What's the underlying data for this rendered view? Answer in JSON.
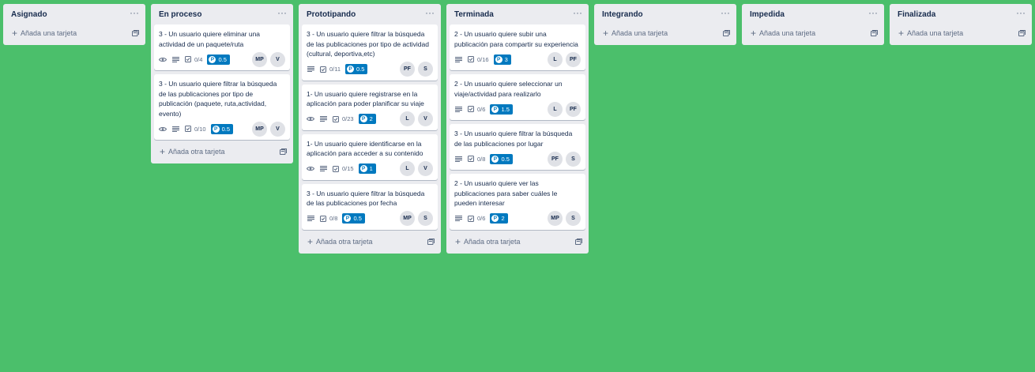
{
  "lists": [
    {
      "title": "Asignado",
      "menu": "···",
      "add_label": "Añada una tarjeta",
      "cards": []
    },
    {
      "title": "En proceso",
      "menu": "···",
      "add_label": "Añada otra tarjeta",
      "cards": [
        {
          "title": "3 - Un usuario quiere eliminar una actividad de un paquete/ruta",
          "watch": true,
          "desc": true,
          "check": "0/4",
          "points": "0.5",
          "members": [
            "MP",
            "V"
          ]
        },
        {
          "title": "3 - Un usuario quiere filtrar la búsqueda de las publicaciones por tipo de publicación (paquete, ruta,actividad, evento)",
          "watch": true,
          "desc": true,
          "check": "0/10",
          "points": "0.5",
          "members": [
            "MP",
            "V"
          ]
        }
      ]
    },
    {
      "title": "Prototipando",
      "menu": "···",
      "add_label": "Añada otra tarjeta",
      "cards": [
        {
          "title": "3 - Un usuario quiere filtrar la búsqueda de las publicaciones por tipo de actividad (cultural, deportiva,etc)",
          "watch": false,
          "desc": true,
          "check": "0/11",
          "points": "0.5",
          "members": [
            "PF",
            "S"
          ]
        },
        {
          "title": "1- Un usuario quiere registrarse en la aplicación para poder planificar su viaje",
          "watch": true,
          "desc": true,
          "check": "0/23",
          "points": "2",
          "members": [
            "L",
            "V"
          ]
        },
        {
          "title": "1- Un usuario quiere identificarse en la aplicación para acceder a su contenido",
          "watch": true,
          "desc": true,
          "check": "0/15",
          "points": "1",
          "members": [
            "L",
            "V"
          ]
        },
        {
          "title": "3 - Un usuario quiere filtrar la búsqueda de las publicaciones por fecha",
          "watch": false,
          "desc": true,
          "check": "0/8",
          "points": "0.5",
          "members": [
            "MP",
            "S"
          ]
        }
      ]
    },
    {
      "title": "Terminada",
      "menu": "···",
      "add_label": "Añada otra tarjeta",
      "cards": [
        {
          "title": "2 - Un usuario quiere subir una publicación para compartir su experiencia",
          "watch": false,
          "desc": true,
          "check": "0/16",
          "points": "3",
          "members": [
            "L",
            "PF"
          ]
        },
        {
          "title": "2 - Un usuario quiere seleccionar un viaje/actividad para realizarlo",
          "watch": false,
          "desc": true,
          "check": "0/6",
          "points": "1.5",
          "members": [
            "L",
            "PF"
          ]
        },
        {
          "title": "3 - Un usuario quiere filtrar la búsqueda de las publicaciones por lugar",
          "watch": false,
          "desc": true,
          "check": "0/8",
          "points": "0.5",
          "members": [
            "PF",
            "S"
          ]
        },
        {
          "title": "2 - Un usuario quiere ver las publicaciones para saber cuáles le pueden interesar",
          "watch": false,
          "desc": true,
          "check": "0/6",
          "points": "2",
          "members": [
            "MP",
            "S"
          ]
        }
      ]
    },
    {
      "title": "Integrando",
      "menu": "···",
      "add_label": "Añada una tarjeta",
      "cards": []
    },
    {
      "title": "Impedida",
      "menu": "···",
      "add_label": "Añada una tarjeta",
      "cards": []
    },
    {
      "title": "Finalizada",
      "menu": "···",
      "add_label": "Añada una tarjeta",
      "cards": []
    }
  ],
  "icons": {
    "watch": "eye-icon",
    "description": "description-icon",
    "checklist": "checklist-icon",
    "points_letter": "P",
    "add": "plus-icon",
    "template": "card-template-icon"
  },
  "colors": {
    "board_background": "#4bbf6b",
    "list_background": "#ebecf0",
    "points_badge": "#0079bf"
  }
}
